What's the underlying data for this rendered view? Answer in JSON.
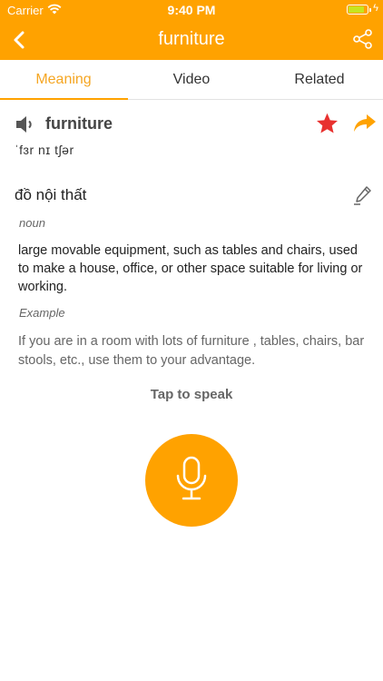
{
  "status_bar": {
    "carrier": "Carrier",
    "time": "9:40 PM",
    "battery_level": 0.85,
    "icons": [
      "wifi-icon",
      "battery-icon",
      "charging-bolt-icon"
    ]
  },
  "header": {
    "title": "furniture",
    "back_icon": "chevron-left-icon",
    "share_icon": "share-nodes-icon",
    "background_color": "#FFA200"
  },
  "tabs": [
    {
      "label": "Meaning",
      "active": true
    },
    {
      "label": "Video",
      "active": false
    },
    {
      "label": "Related",
      "active": false
    }
  ],
  "entry": {
    "word": "furniture",
    "phonetic": "ˈfɜr nɪ tʃər",
    "translation": "đồ nội thất",
    "part_of_speech": "noun",
    "definition": "large movable equipment, such as tables and chairs, used to make a house, office, or other space suitable for living or working.",
    "example_label": "Example",
    "example": "If you are in a room with lots of furniture , tables, chairs, bar stools, etc., use them to your advantage.",
    "favorite_color": "#E8312F",
    "icons": [
      "speaker-icon",
      "star-icon",
      "share-arrow-icon",
      "pencil-icon"
    ]
  },
  "speak": {
    "label": "Tap to speak",
    "icon": "microphone-icon"
  }
}
